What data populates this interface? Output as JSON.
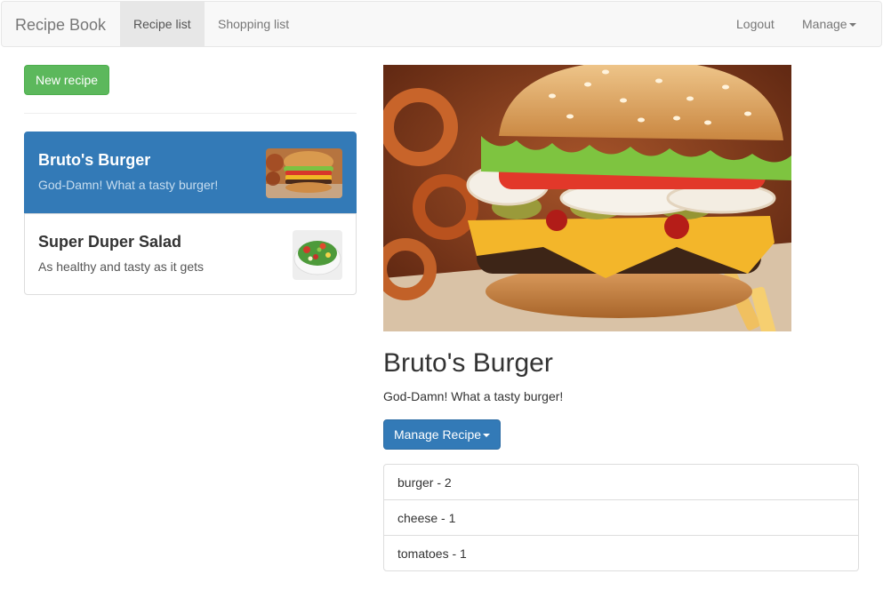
{
  "navbar": {
    "brand": "Recipe Book",
    "links": [
      {
        "label": "Recipe list",
        "active": true
      },
      {
        "label": "Shopping list",
        "active": false
      }
    ],
    "right": {
      "logout": "Logout",
      "manage": "Manage"
    }
  },
  "sidebar": {
    "new_recipe_label": "New recipe",
    "recipes": [
      {
        "name": "Bruto's Burger",
        "description": "God-Damn! What a tasty burger!",
        "image": "burger-photo",
        "selected": true
      },
      {
        "name": "Super Duper Salad",
        "description": "As healthy and tasty as it gets",
        "image": "salad-photo",
        "selected": false
      }
    ]
  },
  "detail": {
    "image": "burger-photo",
    "title": "Bruto's Burger",
    "description": "God-Damn! What a tasty burger!",
    "manage_label": "Manage Recipe",
    "ingredients": [
      "burger - 2",
      "cheese - 1",
      "tomatoes - 1"
    ]
  },
  "colors": {
    "primary": "#337ab7",
    "success": "#5cb85c",
    "navbar_bg": "#f8f8f8",
    "active_nav": "#e7e7e7"
  }
}
